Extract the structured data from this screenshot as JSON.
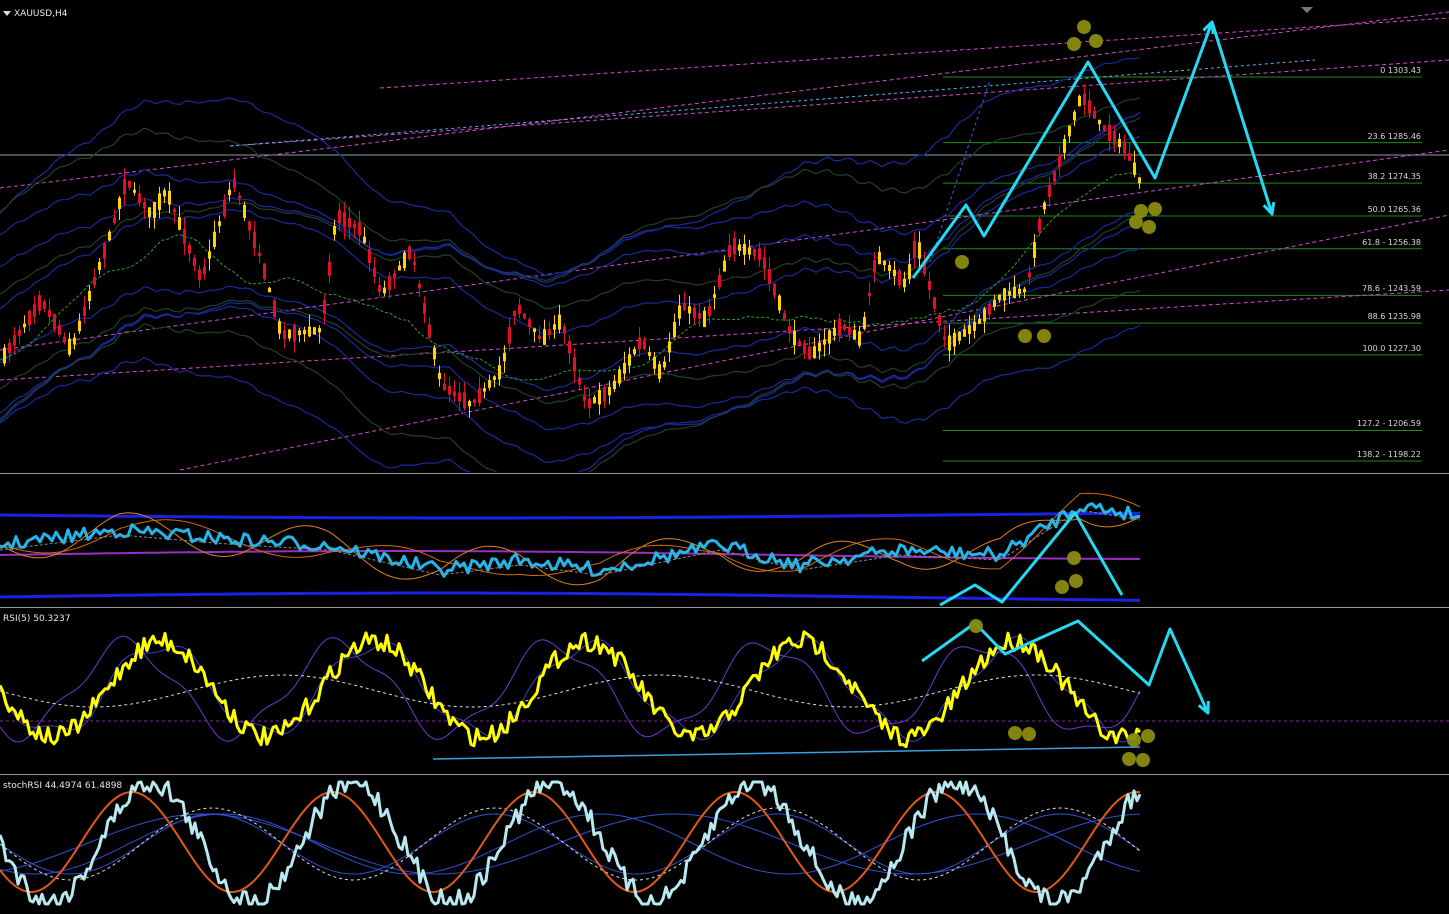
{
  "chart_title": "XAUUSD,H4",
  "rsi_title": "RSI(5) 50.3237",
  "stoch_title": "stochRSI 44.4974 61.4898",
  "colors": {
    "bull": "#ffd400",
    "bear": "#e0102a",
    "annotation": "#26d9f2",
    "fib_line": "#1e8c1e",
    "channel": "#d04ad0",
    "marker": "#8a8a10",
    "band": "#1a2a9a"
  },
  "chart_data": [
    {
      "type": "candlestick",
      "title": "XAUUSD,H4",
      "fibonacci_levels": [
        {
          "label": "0 1303.43",
          "pct": 0,
          "price": 1303.43
        },
        {
          "label": "23.6 1285.46",
          "pct": 23.6,
          "price": 1285.46
        },
        {
          "label": "38.2 1274.35",
          "pct": 38.2,
          "price": 1274.35
        },
        {
          "label": "50.0 1265.36",
          "pct": 50.0,
          "price": 1265.36
        },
        {
          "label": "61.8 - 1256.38",
          "pct": 61.8,
          "price": 1256.38
        },
        {
          "label": "78.6 - 1243.59",
          "pct": 78.6,
          "price": 1243.59
        },
        {
          "label": "88.6 1235.98",
          "pct": 88.6,
          "price": 1235.98
        },
        {
          "label": "100.0 1227.30",
          "pct": 100.0,
          "price": 1227.3
        },
        {
          "label": "127.2 - 1206.59",
          "pct": 127.2,
          "price": 1206.59
        },
        {
          "label": "138.2 - 1198.22",
          "pct": 138.2,
          "price": 1198.22
        }
      ]
    },
    {
      "type": "line",
      "title": "RSI(5) 50.3237",
      "value": 50.3237
    },
    {
      "type": "line",
      "title": "stochRSI 44.4974 61.4898",
      "values": [
        44.4974,
        61.4898
      ]
    }
  ]
}
